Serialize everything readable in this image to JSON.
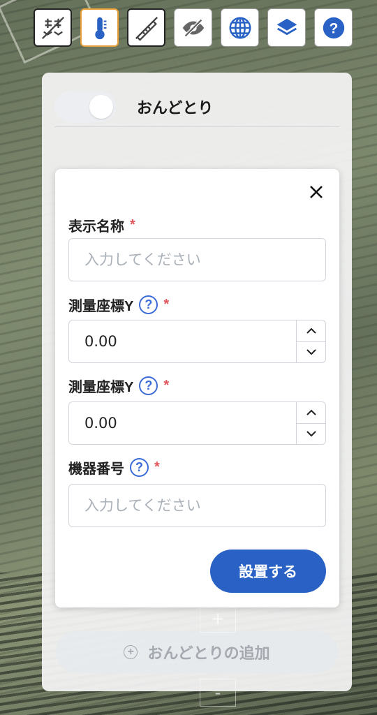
{
  "toolbar": {
    "buttons": [
      {
        "icon": "grid-slash-icon"
      },
      {
        "icon": "thermometer-icon"
      },
      {
        "icon": "ruler-slash-icon"
      },
      {
        "icon": "eye-slash-icon"
      },
      {
        "icon": "globe-icon"
      },
      {
        "icon": "layers-icon"
      },
      {
        "icon": "help-icon"
      }
    ],
    "active_color": "#e9a23b",
    "accent_color": "#2962c4"
  },
  "layer_panel": {
    "title": "おんどとり",
    "add_label": "おんどとりの追加",
    "zoom_in": "+",
    "zoom_out": "-"
  },
  "dialog": {
    "fields": {
      "display_name": {
        "label": "表示名称",
        "placeholder": "入力してください",
        "value": "",
        "required": "*"
      },
      "coord_y1": {
        "label": "測量座標Y",
        "value": "0.00",
        "required": "*"
      },
      "coord_y2": {
        "label": "測量座標Y",
        "value": "0.00",
        "required": "*"
      },
      "device_no": {
        "label": "機器番号",
        "placeholder": "入力してください",
        "value": "",
        "required": "*"
      }
    },
    "help_glyph": "?",
    "submit_label": "設置する"
  }
}
